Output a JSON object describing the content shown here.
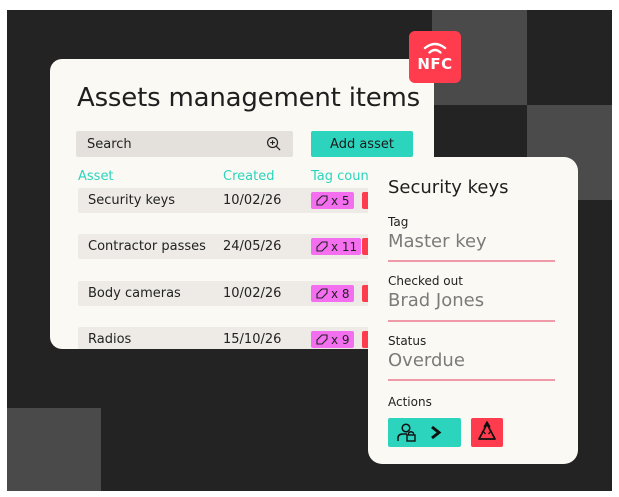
{
  "nfc_badge": {
    "label": "NFC"
  },
  "assets_card": {
    "title": "Assets management items",
    "search": {
      "placeholder": "Search"
    },
    "add_button_label": "Add asset",
    "columns": [
      "Asset",
      "Created",
      "Tag count"
    ],
    "rows": [
      {
        "asset": "Security keys",
        "created": "10/02/26",
        "tag_count": "x 5"
      },
      {
        "asset": "Contractor passes",
        "created": "24/05/26",
        "tag_count": "x 11"
      },
      {
        "asset": "Body cameras",
        "created": "10/02/26",
        "tag_count": "x 8"
      },
      {
        "asset": "Radios",
        "created": "15/10/26",
        "tag_count": "x 9"
      }
    ]
  },
  "detail_panel": {
    "title": "Security keys",
    "fields": [
      {
        "label": "Tag",
        "value": "Master key"
      },
      {
        "label": "Checked out",
        "value": "Brad Jones"
      },
      {
        "label": "Status",
        "value": "Overdue"
      }
    ],
    "actions_label": "Actions",
    "actions": [
      {
        "icon": "user-lock-arrow-icon"
      },
      {
        "icon": "recycle-icon"
      }
    ]
  },
  "colors": {
    "accent_teal": "#2cd4bd",
    "accent_red": "#ff3b4e",
    "tag_pink": "#f36ff0",
    "underline_pink": "#ef9aa8",
    "background_dark": "#232323"
  }
}
